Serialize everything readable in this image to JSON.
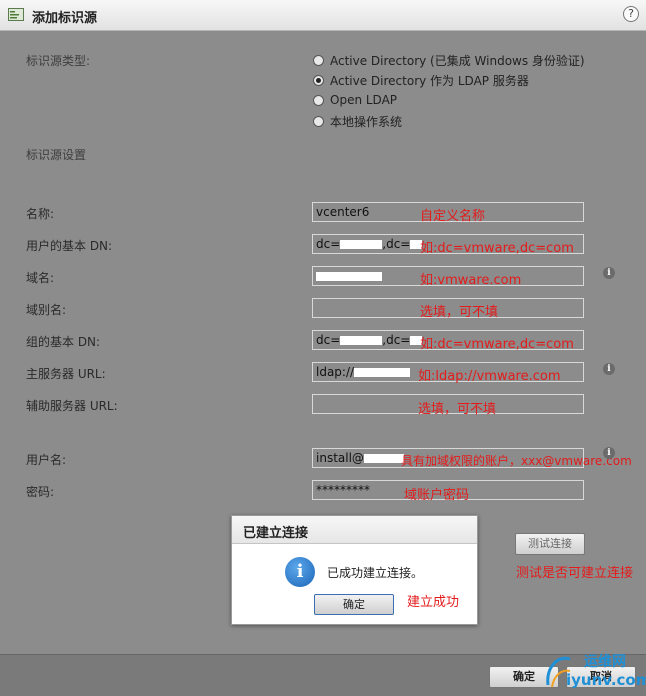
{
  "window": {
    "title": "添加标识源",
    "help_label": "?"
  },
  "identity_source_type": {
    "label": "标识源类型:",
    "options": [
      {
        "label": "Active Directory (已集成 Windows 身份验证)",
        "selected": false
      },
      {
        "label": "Active Directory 作为 LDAP 服务器",
        "selected": true
      },
      {
        "label": "Open LDAP",
        "selected": false
      },
      {
        "label": "本地操作系统",
        "selected": false
      }
    ]
  },
  "settings_heading": "标识源设置",
  "fields": {
    "name": {
      "label": "名称:",
      "value": "vcenter6",
      "note": "自定义名称"
    },
    "user_base_dn": {
      "label": "用户的基本 DN:",
      "value_prefix": "dc=",
      "value_mid": ",dc=",
      "note": "如:dc=vmware,dc=com"
    },
    "domain_name": {
      "label": "域名:",
      "note": "如:vmware.com"
    },
    "domain_alias": {
      "label": "域别名:",
      "note": "选填，可不填"
    },
    "group_base_dn": {
      "label": "组的基本 DN:",
      "value_prefix": "dc=",
      "value_mid": ",dc=",
      "note": "如:dc=vmware,dc=com"
    },
    "primary_server_url": {
      "label": "主服务器 URL:",
      "value_prefix": "ldap://",
      "note": "如:ldap://vmware.com"
    },
    "secondary_server_url": {
      "label": "辅助服务器 URL:",
      "note": "选填，可不填"
    },
    "username": {
      "label": "用户名:",
      "value_prefix": "install@",
      "note": "具有加域权限的账户，xxx@vmware.com"
    },
    "password": {
      "label": "密码:",
      "value": "*********",
      "note": "域账户密码"
    }
  },
  "test_connection": {
    "label": "测试连接",
    "note": "测试是否可建立连接"
  },
  "dialog": {
    "title": "已建立连接",
    "message": "已成功建立连接。",
    "ok_label": "确定",
    "note": "建立成功"
  },
  "footer": {
    "ok_label": "确定",
    "cancel_label": "取消"
  },
  "watermark": {
    "text_cn": "运维网",
    "text_url": "iyunv.com"
  },
  "colors": {
    "annotation": "#e41b1b",
    "info_icon": "#1b64b8"
  }
}
